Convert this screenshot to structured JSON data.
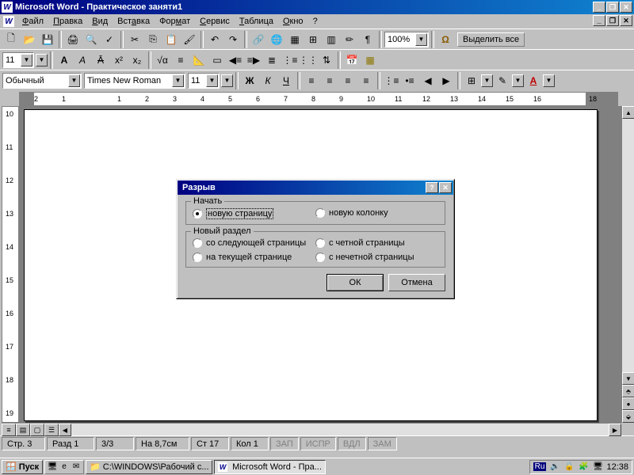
{
  "app": {
    "title": "Microsoft Word - Практическое заняти1"
  },
  "menu": {
    "file": "Файл",
    "edit": "Правка",
    "view": "Вид",
    "insert": "Вставка",
    "format": "Формат",
    "tools": "Сервис",
    "table": "Таблица",
    "window": "Окно",
    "help": "?"
  },
  "toolbar1": {
    "zoom": "100%",
    "select_all": "Выделить все"
  },
  "toolbar3": {
    "style": "Обычный",
    "font": "Times New Roman",
    "size": "11"
  },
  "dialog": {
    "title": "Разрыв",
    "group1_label": "Начать",
    "opt_new_page": "новую страницу",
    "opt_new_column": "новую колонку",
    "group2_label": "Новый раздел",
    "opt_next_page": "со следующей страницы",
    "opt_current_page": "на текущей странице",
    "opt_even_page": "с четной страницы",
    "opt_odd_page": "с нечетной страницы",
    "ok": "ОК",
    "cancel": "Отмена"
  },
  "status": {
    "page": "Стр. 3",
    "section": "Разд 1",
    "pages": "3/3",
    "at": "На 8,7см",
    "line": "Ст 17",
    "col": "Кол 1",
    "rec": "ЗАП",
    "trk": "ИСПР",
    "ext": "ВДЛ",
    "ovr": "ЗАМ"
  },
  "taskbar": {
    "start": "Пуск",
    "task1": "C:\\WINDOWS\\Рабочий с...",
    "task2": "Microsoft Word - Пра...",
    "lang": "Ru",
    "clock": "12:38"
  },
  "ruler_h": [
    "2",
    "1",
    "",
    "1",
    "2",
    "3",
    "4",
    "5",
    "6",
    "7",
    "8",
    "9",
    "10",
    "11",
    "12",
    "13",
    "14",
    "15",
    "16",
    "",
    "18"
  ]
}
